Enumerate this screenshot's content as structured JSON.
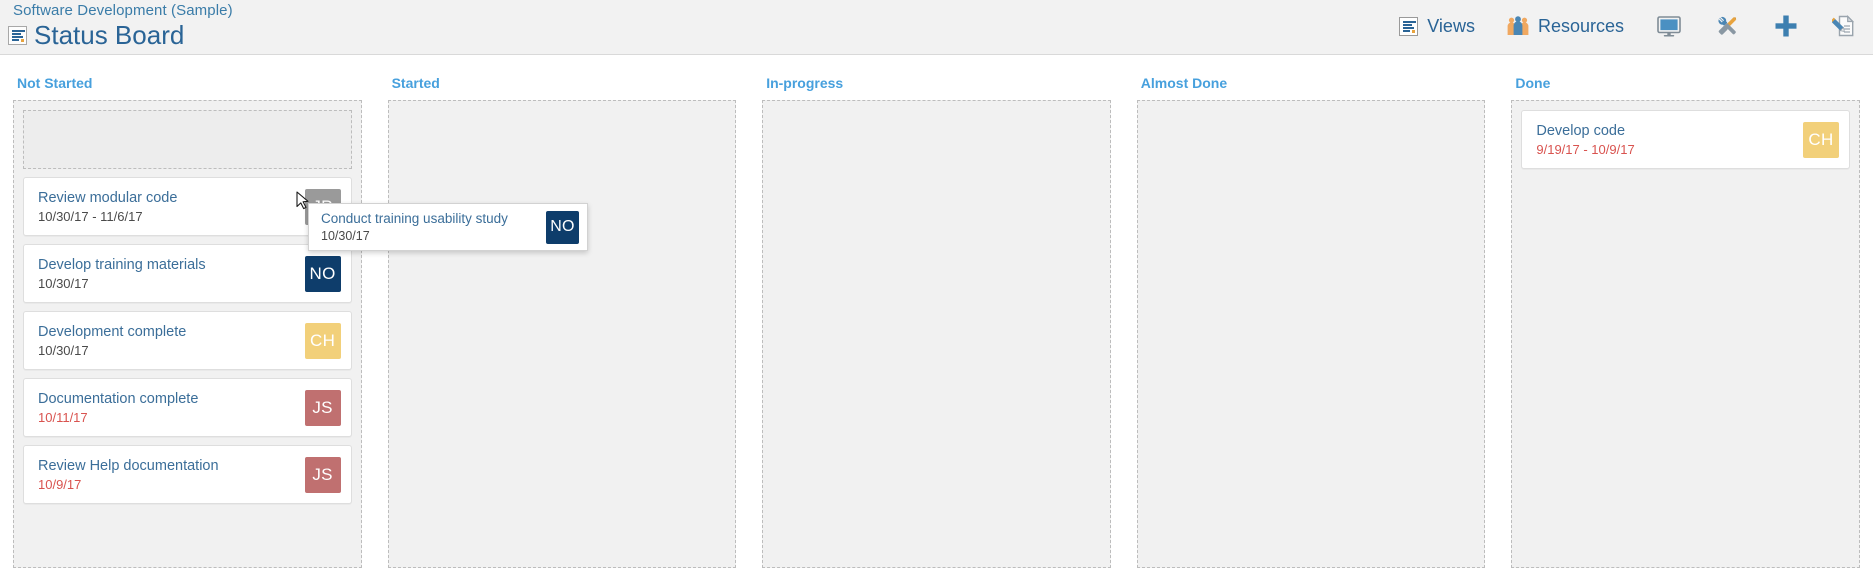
{
  "header": {
    "breadcrumb": "Software Development (Sample)",
    "title": "Status Board",
    "board_icon": "board-icon",
    "toolbar": [
      {
        "icon": "views-icon",
        "label": "Views"
      },
      {
        "icon": "resources-icon",
        "label": "Resources"
      },
      {
        "icon": "monitor-icon",
        "label": ""
      },
      {
        "icon": "tools-icon",
        "label": ""
      },
      {
        "icon": "plus-icon",
        "label": ""
      },
      {
        "icon": "edit-document-icon",
        "label": ""
      }
    ]
  },
  "colors": {
    "accent_blue": "#47a0dd",
    "title_blue": "#2a6496",
    "card_title": "#3b6e99",
    "overdue_red": "#d9534f",
    "avatar_gray": "#9a9a9a",
    "avatar_navy": "#0e3d6b",
    "avatar_yellow": "#f2d07a",
    "avatar_rose": "#c07070",
    "board_bg": "#f1f1f1",
    "header_bg": "#f2f2f2"
  },
  "board": {
    "columns": [
      {
        "title": "Not Started",
        "has_drop_placeholder": true,
        "cards": [
          {
            "title": "Review modular code",
            "date": "10/30/17 - 11/6/17",
            "overdue": false,
            "initials": "JP",
            "avatar_color": "#9a9a9a"
          },
          {
            "title": "Develop training materials",
            "date": "10/30/17",
            "overdue": false,
            "initials": "NO",
            "avatar_color": "#0e3d6b"
          },
          {
            "title": "Development complete",
            "date": "10/30/17",
            "overdue": false,
            "initials": "CH",
            "avatar_color": "#f2d07a"
          },
          {
            "title": "Documentation complete",
            "date": "10/11/17",
            "overdue": true,
            "initials": "JS",
            "avatar_color": "#c07070"
          },
          {
            "title": "Review Help documentation",
            "date": "10/9/17",
            "overdue": true,
            "initials": "JS",
            "avatar_color": "#c07070"
          }
        ]
      },
      {
        "title": "Started",
        "has_drop_placeholder": false,
        "cards": []
      },
      {
        "title": "In-progress",
        "has_drop_placeholder": false,
        "cards": []
      },
      {
        "title": "Almost Done",
        "has_drop_placeholder": false,
        "cards": []
      },
      {
        "title": "Done",
        "has_drop_placeholder": false,
        "cards": [
          {
            "title": "Develop code",
            "date": "9/19/17 - 10/9/17",
            "overdue": true,
            "initials": "CH",
            "avatar_color": "#f2d07a"
          }
        ]
      }
    ]
  },
  "drag": {
    "card": {
      "title": "Conduct training usability study",
      "date": "10/30/17",
      "overdue": false,
      "initials": "NO",
      "avatar_color": "#0e3d6b"
    },
    "cursor": "mouse-pointer"
  }
}
